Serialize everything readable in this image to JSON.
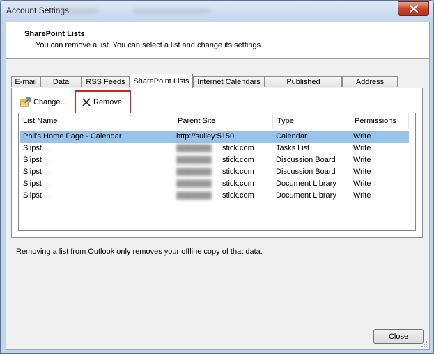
{
  "window": {
    "title": "Account Settings"
  },
  "header": {
    "title": "SharePoint Lists",
    "description": "You can remove a list. You can select a list and change its settings."
  },
  "tabs": [
    {
      "label": "E-mail"
    },
    {
      "label": "Data Files"
    },
    {
      "label": "RSS Feeds"
    },
    {
      "label": "SharePoint Lists",
      "active": true
    },
    {
      "label": "Internet Calendars"
    },
    {
      "label": "Published Calendars"
    },
    {
      "label": "Address Books"
    }
  ],
  "toolbar": {
    "change_label": "Change...",
    "remove_label": "Remove"
  },
  "list": {
    "columns": [
      "List Name",
      "Parent Site",
      "Type",
      "Permissions"
    ],
    "rows": [
      {
        "name": "Phil's Home Page - Calendar",
        "site": "http://sulley:5150",
        "type": "Calendar",
        "permissions": "Write",
        "selected": true
      },
      {
        "name": "Slipst",
        "name_tail": "…",
        "site_tail": "stick.com",
        "type": "Tasks List",
        "permissions": "Write"
      },
      {
        "name": "Slipst",
        "name_tail": "…",
        "site_tail": "stick.com",
        "type": "Discussion Board",
        "permissions": "Write"
      },
      {
        "name": "Slipst",
        "name_tail": "…",
        "site_tail": "stick.com",
        "type": "Discussion Board",
        "permissions": "Write"
      },
      {
        "name": "Slipst",
        "name_tail": "…",
        "site_tail": "stick.com",
        "type": "Document Library",
        "permissions": "Write"
      },
      {
        "name": "Slipst",
        "name_tail": "…",
        "site_tail": "stick.com",
        "type": "Document Library",
        "permissions": "Write"
      }
    ]
  },
  "note": "Removing a list from Outlook only removes your offline copy of that data.",
  "footer": {
    "close_label": "Close"
  },
  "colors": {
    "selection": "#99c3ea",
    "highlight": "#c0282a",
    "close_button": "#c7452b"
  }
}
